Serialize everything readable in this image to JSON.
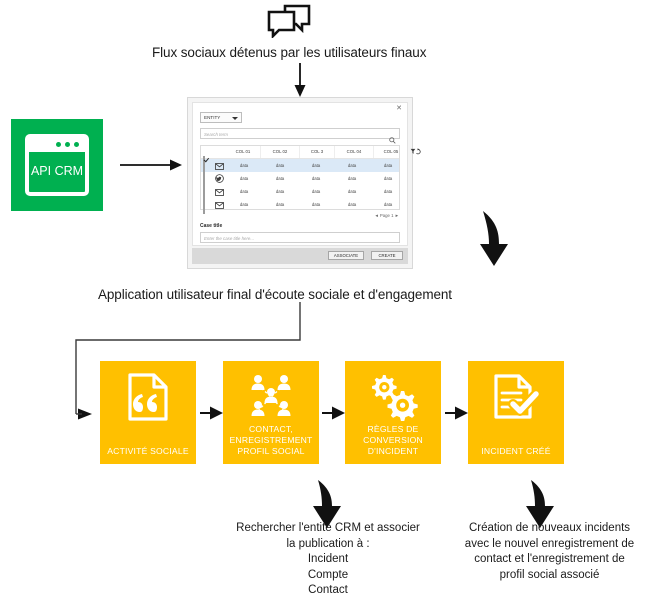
{
  "colors": {
    "green": "#00b050",
    "amber": "#FFC000",
    "text": "#1b1b1b",
    "selected_row": "#dbe9f7"
  },
  "top": {
    "chat_icon": "chat-bubbles-icon",
    "caption": "Flux sociaux détenus par les utilisateurs finaux"
  },
  "api_crm": {
    "label": "API CRM",
    "icon": "browser-window-icon"
  },
  "dialog": {
    "close_label": "✕",
    "entity_select": {
      "value": "ENTITY",
      "caret_icon": "chevron-down-icon"
    },
    "search": {
      "placeholder": "Search term",
      "icon": "search-icon"
    },
    "grid": {
      "columns": [
        "COL 01",
        "COL 02",
        "COL 3",
        "COL 04",
        "COL 05"
      ],
      "sortable": [
        true,
        true,
        false,
        true,
        false
      ],
      "header_icons": [
        "filter-icon",
        "refresh-icon"
      ],
      "rows": [
        {
          "checked": true,
          "icon": "email-icon",
          "cells": [
            "data",
            "data",
            "data",
            "data",
            "data"
          ]
        },
        {
          "checked": false,
          "icon": "twitter-icon",
          "cells": [
            "data",
            "data",
            "data",
            "data",
            "data"
          ]
        },
        {
          "checked": false,
          "icon": "email-icon",
          "cells": [
            "data",
            "data",
            "data",
            "data",
            "data"
          ]
        },
        {
          "checked": false,
          "icon": "email-icon",
          "cells": [
            "data",
            "data",
            "data",
            "data",
            "data"
          ]
        }
      ]
    },
    "pager": "Page 1",
    "case_title_label": "Case title",
    "case_title_placeholder": "Enter the case title here...",
    "associate_label": "ASSOCIATE",
    "create_label": "CREATE"
  },
  "middle": {
    "caption": "Application utilisateur final d'écoute sociale et d'engagement"
  },
  "flow": {
    "tiles": [
      {
        "label": "ACTIVITÉ SOCIALE",
        "icon": "document-quote-icon"
      },
      {
        "label": "CONTACT,\nENREGISTREMENT\nPROFIL SOCIAL",
        "icon": "people-network-icon"
      },
      {
        "label": "RÈGLES DE\nCONVERSION\nD'INCIDENT",
        "icon": "gears-icon"
      },
      {
        "label": "INCIDENT CRÉÉ",
        "icon": "document-check-icon"
      }
    ]
  },
  "bottom": {
    "lookup_text": "Rechercher l'entité CRM et associer\nla publication à :\nIncident\nCompte\nContact",
    "creation_text": "Création de nouveaux incidents\navec le nouvel enregistrement de\ncontact et l'enregistrement de\nprofil social associé"
  }
}
